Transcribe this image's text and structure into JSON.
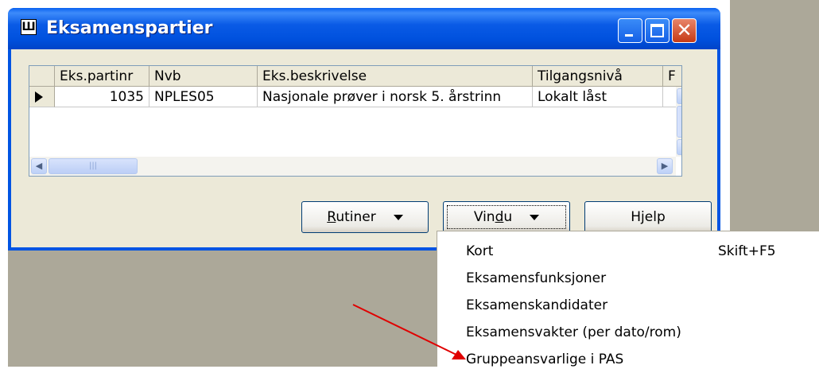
{
  "window": {
    "title": "Eksamenspartier",
    "close_glyph": "✕",
    "app_icon_glyph": "Ш"
  },
  "grid": {
    "columns": [
      "Eks.partinr",
      "Nvb",
      "Eks.beskrivelse",
      "Tilgangsnivå",
      "F"
    ],
    "rows": [
      {
        "partinr": "1035",
        "nvb": "NPLES05",
        "beskrivelse": "Nasjonale prøver i norsk 5. årstrinn",
        "tilgang": "Lokalt låst"
      }
    ]
  },
  "buttons": {
    "rutiner": {
      "label_pre": "",
      "label_ul": "R",
      "label_post": "utiner"
    },
    "vindu": {
      "label_pre": "Vin",
      "label_ul": "d",
      "label_post": "u"
    },
    "hjelp": {
      "label": "Hjelp"
    }
  },
  "menu": {
    "items": [
      {
        "label": "Kort",
        "shortcut": "Skift+F5"
      },
      {
        "label": "Eksamensfunksjoner",
        "shortcut": ""
      },
      {
        "label": "Eksamenskandidater",
        "shortcut": ""
      },
      {
        "label": "Eksamensvakter (per dato/rom)",
        "shortcut": ""
      },
      {
        "label": "Gruppeansvarlige i PAS",
        "shortcut": ""
      }
    ]
  },
  "colors": {
    "titlebar": "#0054e3",
    "dialog_face": "#ece9d8",
    "desktop": "#aca899",
    "annotation_arrow": "#e00000"
  },
  "icons": {
    "scroll_up": "▲",
    "scroll_down": "▼",
    "scroll_left": "◀",
    "scroll_right": "▶",
    "thumb_grip": "≡",
    "thumb_grip_h": "|||"
  }
}
